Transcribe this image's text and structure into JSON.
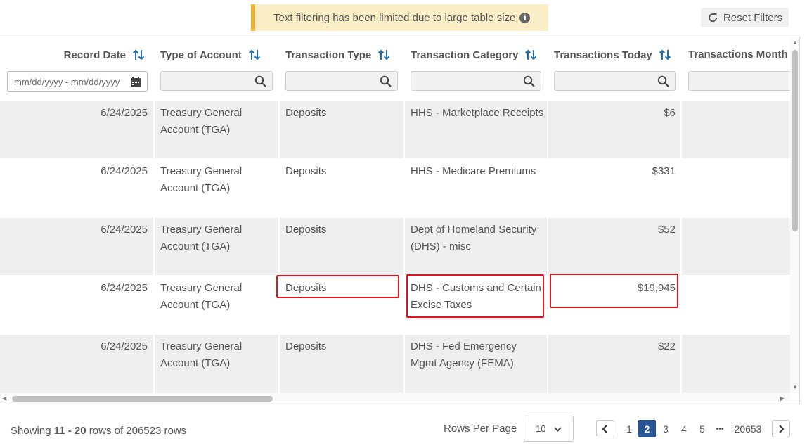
{
  "notice": {
    "text": "Text filtering has been limited due to large table size",
    "icon": "info-icon"
  },
  "reset_button": {
    "label": "Reset Filters",
    "icon": "reset-icon"
  },
  "columns": [
    {
      "label": "Record Date"
    },
    {
      "label": "Type of Account"
    },
    {
      "label": "Transaction Type"
    },
    {
      "label": "Transaction Category"
    },
    {
      "label": "Transactions Today"
    },
    {
      "label": "Transactions Month"
    }
  ],
  "date_filter": {
    "placeholder": "mm/dd/yyyy - mm/dd/yyyy"
  },
  "rows": [
    {
      "record_date": "6/24/2025",
      "type_of_account": [
        "Treasury General",
        "Account (TGA)"
      ],
      "transaction_type": "Deposits",
      "transaction_category": [
        "HHS - Marketplace Receipts"
      ],
      "transactions_today": "$6",
      "transactions_month": ""
    },
    {
      "record_date": "6/24/2025",
      "type_of_account": [
        "Treasury General",
        "Account (TGA)"
      ],
      "transaction_type": "Deposits",
      "transaction_category": [
        "HHS - Medicare Premiums"
      ],
      "transactions_today": "$331",
      "transactions_month": ""
    },
    {
      "record_date": "6/24/2025",
      "type_of_account": [
        "Treasury General",
        "Account (TGA)"
      ],
      "transaction_type": "Deposits",
      "transaction_category": [
        "Dept of Homeland Security",
        "(DHS) - misc"
      ],
      "transactions_today": "$52",
      "transactions_month": ""
    },
    {
      "record_date": "6/24/2025",
      "type_of_account": [
        "Treasury General",
        "Account (TGA)"
      ],
      "transaction_type": "Deposits",
      "transaction_category": [
        "DHS - Customs and Certain",
        "Excise Taxes"
      ],
      "transactions_today": "$19,945",
      "transactions_month": ""
    },
    {
      "record_date": "6/24/2025",
      "type_of_account": [
        "Treasury General",
        "Account (TGA)"
      ],
      "transaction_type": "Deposits",
      "transaction_category": [
        "DHS - Fed Emergency",
        "Mgmt Agency (FEMA)"
      ],
      "transactions_today": "$22",
      "transactions_month": ""
    }
  ],
  "footer": {
    "showing_prefix": "Showing ",
    "showing_range": "11 - 20",
    "showing_suffix": " rows of 206523 rows",
    "rows_per_page_label": "Rows Per Page",
    "rows_per_page_value": "10",
    "pages": [
      "1",
      "2",
      "3",
      "4",
      "5",
      "•••",
      "20653"
    ],
    "current_page": "2"
  },
  "colors": {
    "highlight": "#e0141e",
    "accent": "#2a5595",
    "notice_bg": "#f9eec6",
    "notice_bar": "#f2b632",
    "sort_icon": "#1f6fb5"
  }
}
